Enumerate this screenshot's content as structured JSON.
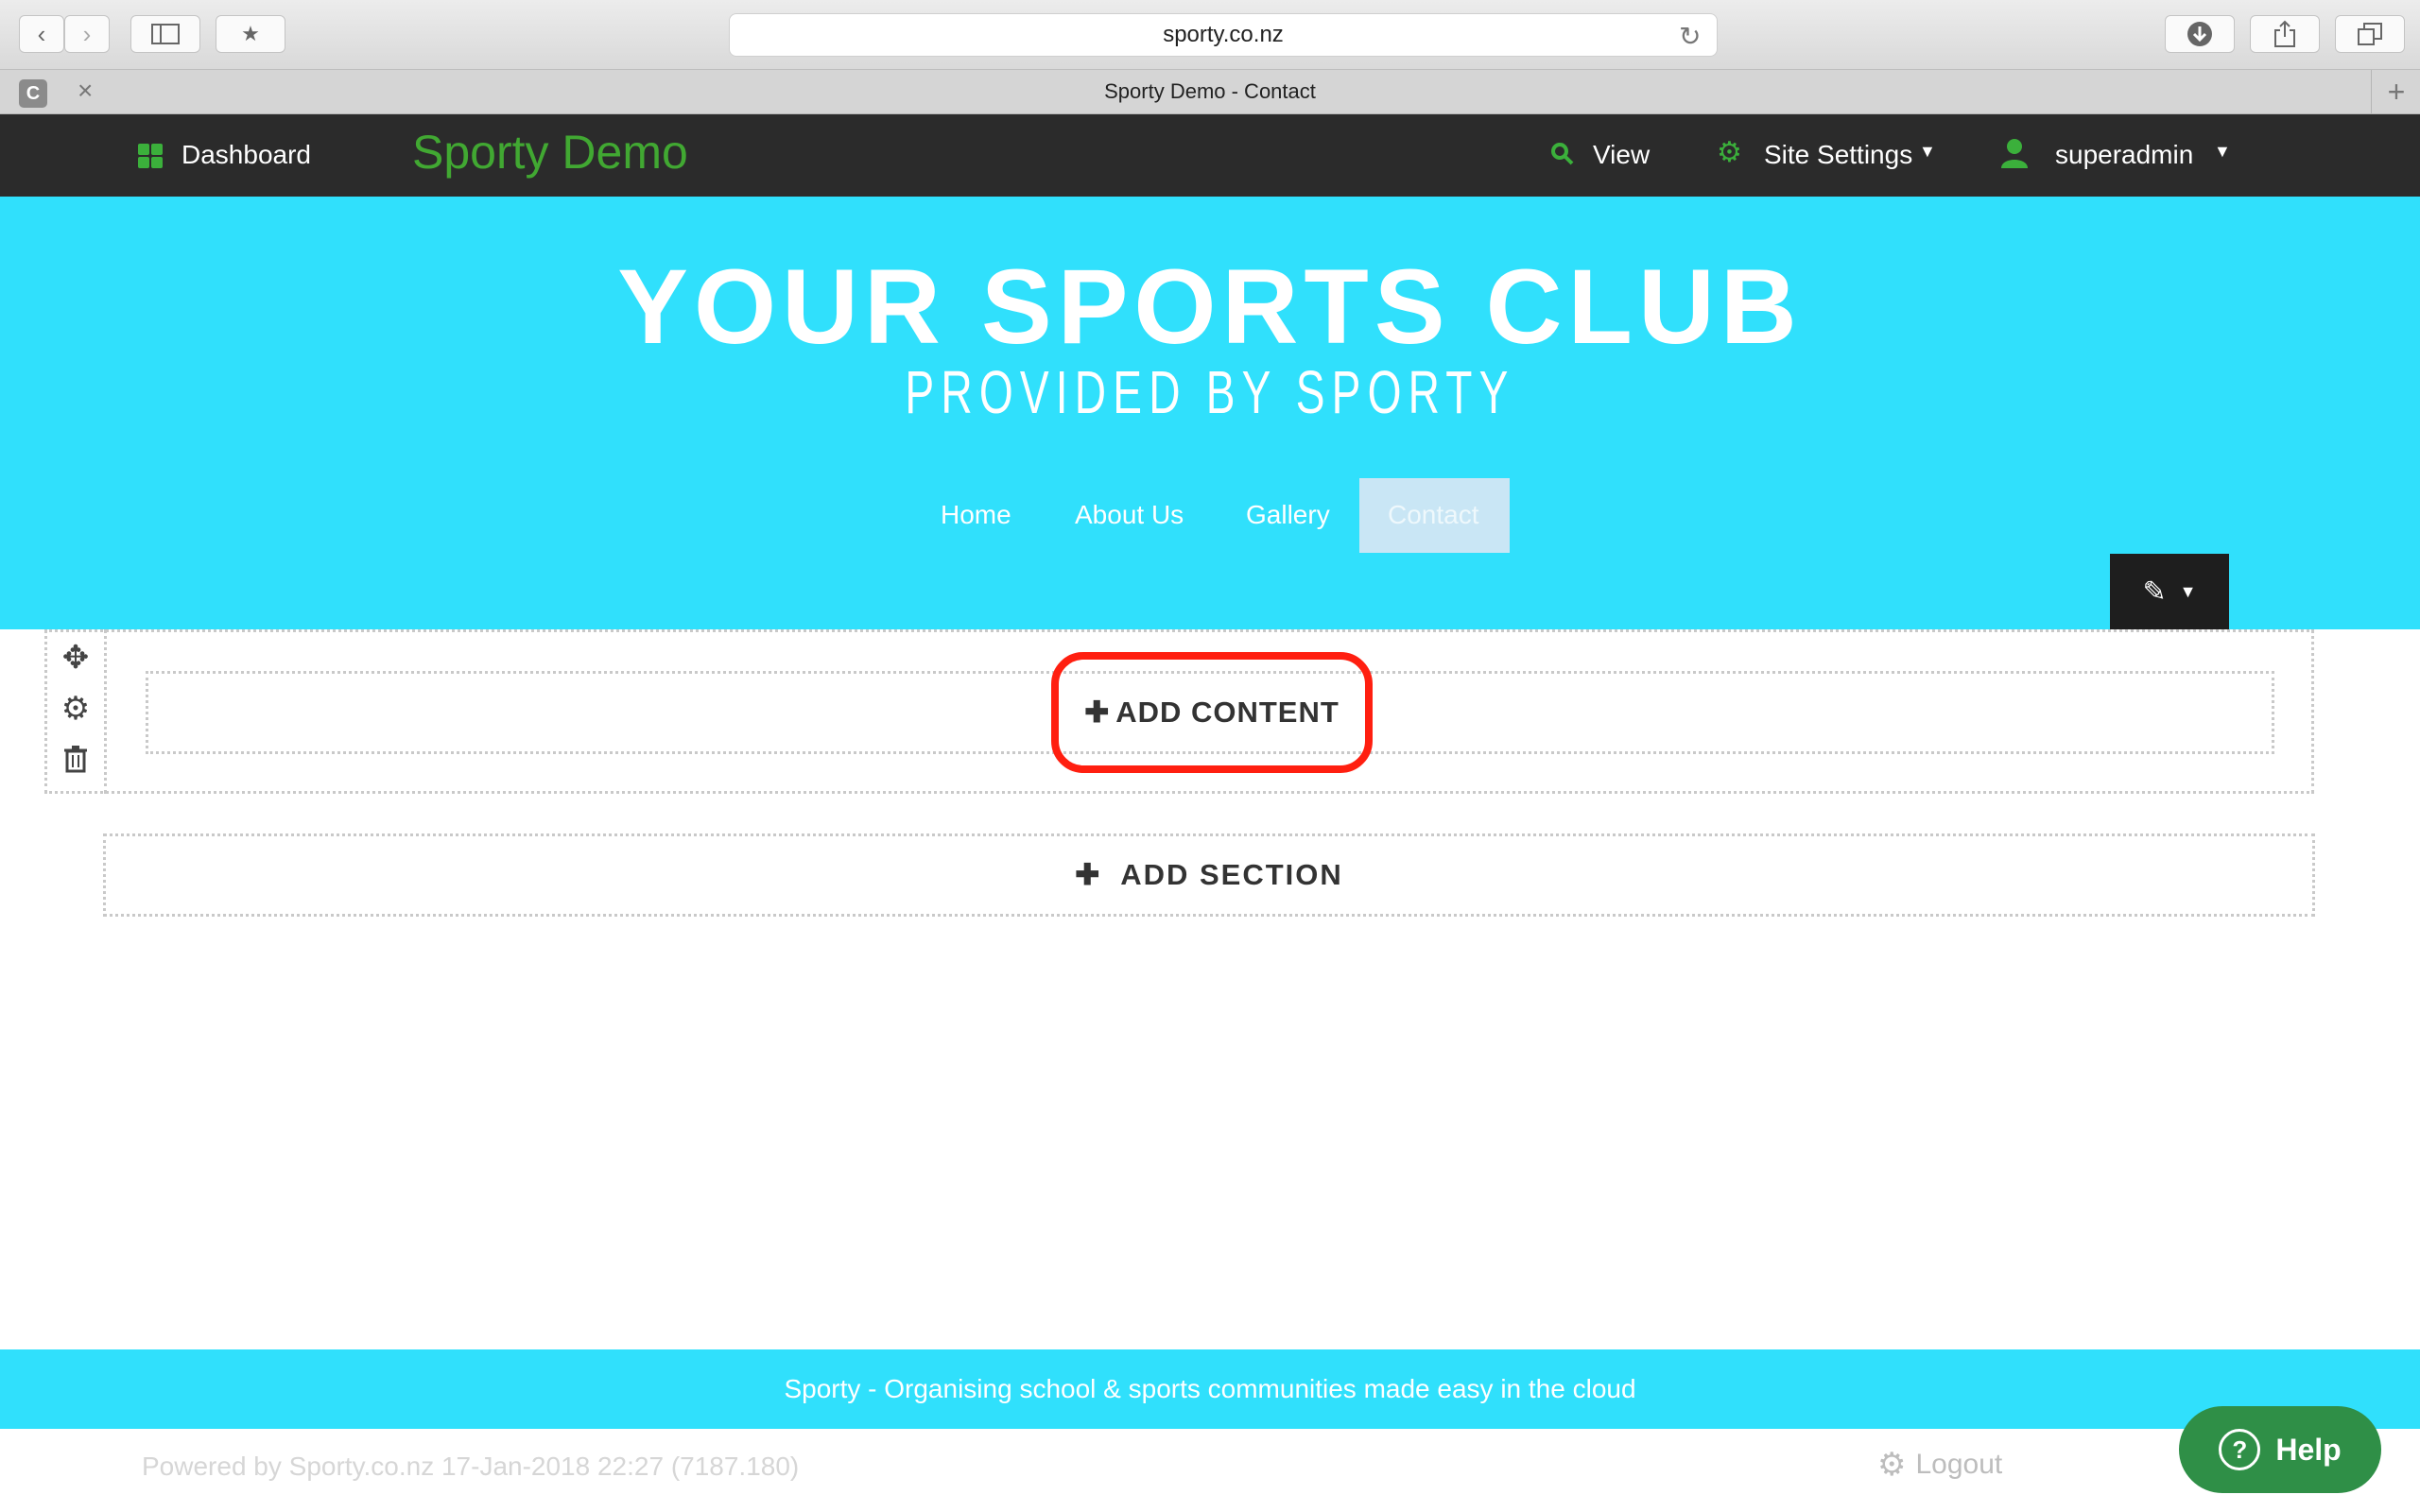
{
  "browser": {
    "url": "sporty.co.nz",
    "tab_title": "Sporty Demo - Contact",
    "tab_favicon_letter": "C"
  },
  "admin_bar": {
    "dashboard_label": "Dashboard",
    "brand": "Sporty Demo",
    "view_label": "View",
    "site_settings_label": "Site Settings",
    "user_label": "superadmin",
    "accent_color": "#3bb03b"
  },
  "header": {
    "title": "YOUR SPORTS CLUB",
    "subtitle": "PROVIDED BY SPORTY",
    "background_color": "#30e0fc",
    "nav": [
      {
        "label": "Home",
        "active": false
      },
      {
        "label": "About Us",
        "active": false
      },
      {
        "label": "Gallery",
        "active": false
      },
      {
        "label": "Contact",
        "active": true
      }
    ]
  },
  "builder": {
    "add_content_label": "ADD CONTENT",
    "add_section_label": "ADD SECTION",
    "highlight_color": "#ff1f10"
  },
  "footer": {
    "tagline": "Sporty - Organising school & sports communities made easy in the cloud",
    "powered_by": "Powered by Sporty.co.nz 17-Jan-2018 22:27 (7187.180)",
    "logout_label": "Logout",
    "help_label": "Help"
  }
}
